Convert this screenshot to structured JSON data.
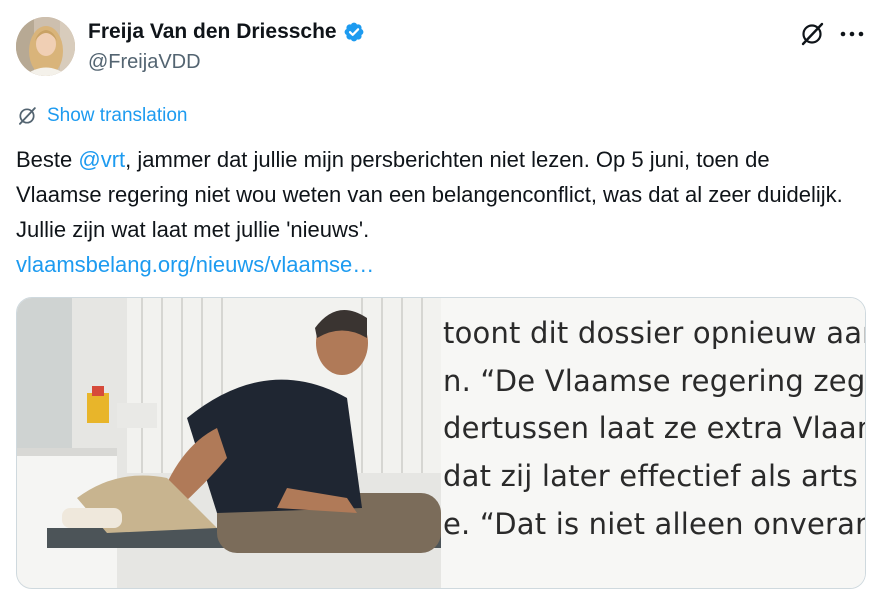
{
  "author": {
    "display_name": "Freija Van den Driessche",
    "handle": "@FreijaVDD",
    "verified": true
  },
  "icons": {
    "verified": "verified-badge-icon",
    "grok": "grok-icon",
    "more": "more-options-icon",
    "translate": "translate-icon"
  },
  "translate": {
    "label": "Show translation"
  },
  "tweet": {
    "prefix": "Beste ",
    "mention": "@vrt",
    "body": ", jammer dat jullie mijn persberichten niet lezen. Op 5 juni, toen de Vlaamse regering niet wou weten van een belangenconflict, was dat al zeer duidelijk. Jullie zijn wat laat met jullie 'nieuws'.",
    "link": "vlaamsbelang.org/nieuws/vlaamse…"
  },
  "card_article": {
    "lines": [
      "toont dit dossier opnieuw aan",
      "n. “De Vlaamse regering zegt",
      "dertussen laat ze extra Vlaam",
      " dat zij later effectief als arts o",
      "e. “Dat is niet alleen onverantw"
    ]
  },
  "colors": {
    "accent": "#1d9bf0",
    "text": "#0f1419",
    "secondary": "#536471",
    "border": "#cfd9de"
  }
}
